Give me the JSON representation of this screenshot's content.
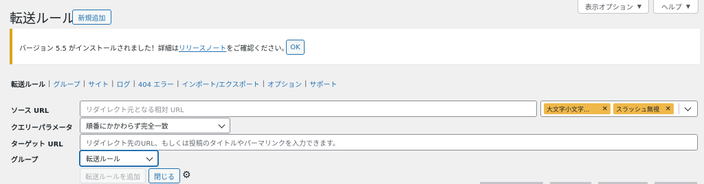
{
  "header": {
    "title": "転送ルール",
    "add_new_label": "新規追加"
  },
  "screen_options": {
    "options_label": "表示オプション",
    "help_label": "ヘルプ"
  },
  "notice": {
    "text_before": "バージョン 5.5 がインストールされました！詳細は",
    "link_text": "リリースノート",
    "text_after": "をご確認ください。",
    "ok_label": "OK",
    "border_color": "#dba617"
  },
  "subnav": {
    "items": [
      {
        "label": "転送ルール",
        "current": true
      },
      {
        "label": "グループ"
      },
      {
        "label": "サイト"
      },
      {
        "label": "ログ"
      },
      {
        "label": "404 エラー"
      },
      {
        "label": "インポート/エクスポート"
      },
      {
        "label": "オプション"
      },
      {
        "label": "サポート"
      }
    ],
    "separator": "|"
  },
  "form": {
    "source_url": {
      "label": "ソース URL",
      "placeholder": "リダイレクト元となる相対 URL",
      "tags": [
        "大文字小文字...",
        "スラッシュ無視"
      ]
    },
    "query": {
      "label": "クエリーパラメータ",
      "value": "順番にかかわらず完全一致"
    },
    "target_url": {
      "label": "ターゲット URL",
      "placeholder": "リダイレクト先のURL、もしくは投稿のタイトルやパーマリンクを入力できます。"
    },
    "group": {
      "label": "グループ",
      "value": "転送ルール"
    },
    "add_rule_label": "転送ルールを追加",
    "close_label": "閉じる"
  },
  "colors": {
    "accent": "#2271b1",
    "background": "#f0f0f1",
    "tag": "#f0b849"
  }
}
